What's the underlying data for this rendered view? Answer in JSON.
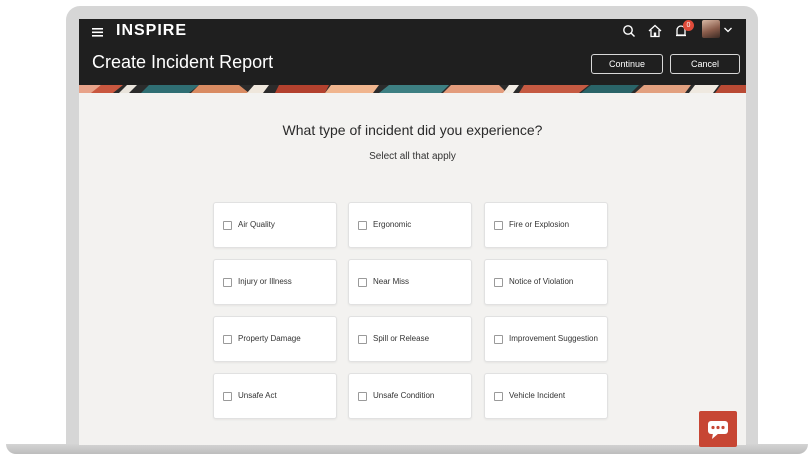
{
  "app": {
    "brand": "INSPIRE",
    "notification_count": "0"
  },
  "header": {
    "title": "Create Incident Report",
    "continue_label": "Continue",
    "cancel_label": "Cancel"
  },
  "form": {
    "question": "What type of incident did you experience?",
    "instruction": "Select all that apply",
    "options": [
      {
        "label": "Air Quality",
        "checked": false
      },
      {
        "label": "Ergonomic",
        "checked": false
      },
      {
        "label": "Fire or Explosion",
        "checked": false
      },
      {
        "label": "Injury or Illness",
        "checked": false
      },
      {
        "label": "Near Miss",
        "checked": false
      },
      {
        "label": "Notice of Violation",
        "checked": false
      },
      {
        "label": "Property Damage",
        "checked": false
      },
      {
        "label": "Spill or Release",
        "checked": false
      },
      {
        "label": "Improvement Suggestion",
        "checked": false
      },
      {
        "label": "Unsafe Act",
        "checked": false
      },
      {
        "label": "Unsafe Condition",
        "checked": false
      },
      {
        "label": "Vehicle Incident",
        "checked": false
      }
    ]
  },
  "icons": {
    "menu": "hamburger-icon",
    "search": "search-icon",
    "home": "home-icon",
    "notifications": "bell-icon",
    "avatar": "user-avatar",
    "chat": "chat-bubble-icon"
  },
  "colors": {
    "header_bg": "#1f1f1f",
    "accent": "#c74634",
    "badge": "#e04b3a",
    "page_bg": "#f3f2f0"
  }
}
